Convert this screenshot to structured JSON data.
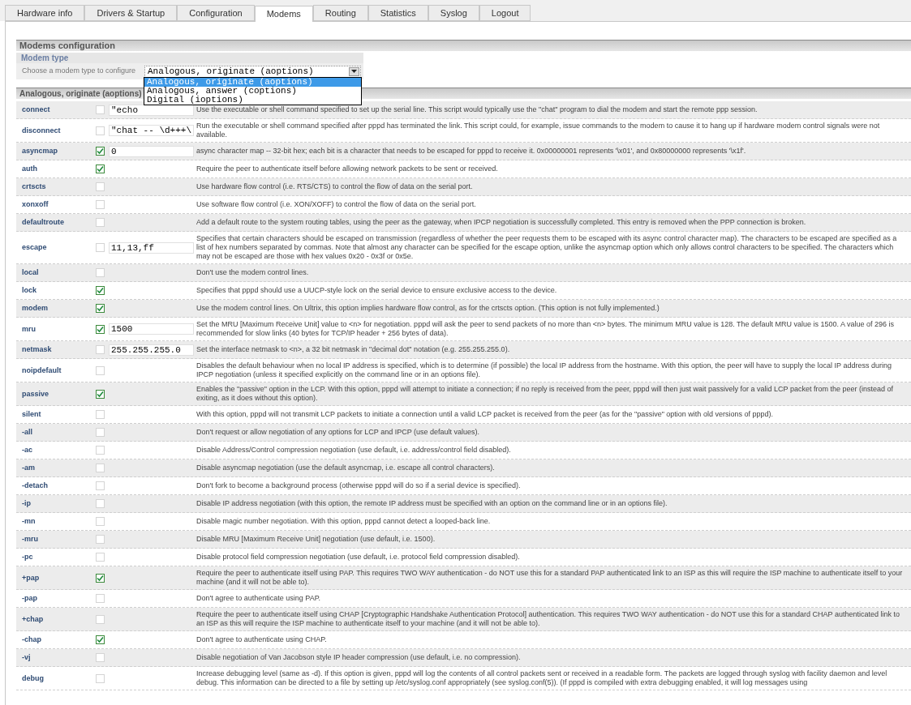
{
  "tabs": [
    {
      "label": "Hardware info",
      "selected": false
    },
    {
      "label": "Drivers & Startup",
      "selected": false
    },
    {
      "label": "Configuration",
      "selected": false
    },
    {
      "label": "Modems",
      "selected": true
    },
    {
      "label": "Routing",
      "selected": false
    },
    {
      "label": "Statistics",
      "selected": false
    },
    {
      "label": "Syslog",
      "selected": false
    },
    {
      "label": "Logout",
      "selected": false
    }
  ],
  "section_title": "Modems configuration",
  "modem_type": {
    "title": "Modem type",
    "label": "Choose a modem type to configure",
    "value": "Analogous, originate (aoptions)",
    "expanded": true,
    "options": [
      {
        "label": "Analogous, originate (aoptions)",
        "selected": true
      },
      {
        "label": "Analogous, answer (coptions)",
        "selected": false
      },
      {
        "label": "Digital (ioptions)",
        "selected": false
      }
    ]
  },
  "options_title": "Analogous, originate (aoptions)",
  "options": [
    {
      "name": "connect",
      "checked": false,
      "value": "\"echo",
      "description": "Use the executable or shell command specified to set up the serial line. This script would typically use the \"chat\" program to dial the modem and start the remote ppp session."
    },
    {
      "name": "disconnect",
      "checked": false,
      "value": "\"chat -- \\d+++\\",
      "description": "Run the executable or shell command specified after pppd has terminated the link. This script could, for example, issue commands to the modem to cause it to hang up if hardware modem control signals were not available."
    },
    {
      "name": "asyncmap",
      "checked": true,
      "value": "0",
      "description": "async character map -- 32-bit hex; each bit is a character that needs to be escaped for pppd to receive it. 0x00000001 represents '\\x01', and 0x80000000 represents '\\x1f'."
    },
    {
      "name": "auth",
      "checked": true,
      "description": "Require the peer to authenticate itself before allowing network packets to be sent or received."
    },
    {
      "name": "crtscts",
      "checked": false,
      "description": "Use hardware flow control (i.e. RTS/CTS) to control the flow of data on the serial port."
    },
    {
      "name": "xonxoff",
      "checked": false,
      "description": "Use software flow control (i.e. XON/XOFF) to control the flow of data on the serial port."
    },
    {
      "name": "defaultroute",
      "checked": false,
      "description": "Add a default route to the system routing tables, using the peer as the gateway, when IPCP negotiation is successfully completed. This entry is removed when the PPP connection is broken."
    },
    {
      "name": "escape",
      "checked": false,
      "value": "11,13,ff",
      "description": "Specifies that certain characters should be escaped on transmission (regardless of whether the peer requests them to be escaped with its async control character map). The characters to be escaped are specified as a list of hex numbers separated by commas. Note that almost any character can be specified for the escape option, unlike the asyncmap option which only allows control characters to be specified. The characters which may not be escaped are those with hex values 0x20 - 0x3f or 0x5e."
    },
    {
      "name": "local",
      "checked": false,
      "description": "Don't use the modem control lines."
    },
    {
      "name": "lock",
      "checked": true,
      "description": "Specifies that pppd should use a UUCP-style lock on the serial device to ensure exclusive access to the device."
    },
    {
      "name": "modem",
      "checked": true,
      "description": "Use the modem control lines. On Ultrix, this option implies hardware flow control, as for the crtscts option. (This option is not fully implemented.)"
    },
    {
      "name": "mru",
      "checked": true,
      "value": "1500",
      "description": "Set the MRU [Maximum Receive Unit] value to <n> for negotiation. pppd will ask the peer to send packets of no more than <n> bytes. The minimum MRU value is 128. The default MRU value is 1500. A value of 296 is recommended for slow links (40 bytes for TCP/IP header + 256 bytes of data)."
    },
    {
      "name": "netmask",
      "checked": false,
      "value": "255.255.255.0",
      "description": "Set the interface netmask to <n>, a 32 bit netmask in \"decimal dot\" notation (e.g. 255.255.255.0)."
    },
    {
      "name": "noipdefault",
      "checked": false,
      "description": "Disables the default behaviour when no local IP address is specified, which is to determine (if possible) the local IP address from the hostname. With this option, the peer will have to supply the local IP address during IPCP negotiation (unless it specified explicitly on the command line or in an options file)."
    },
    {
      "name": "passive",
      "checked": true,
      "description": "Enables the \"passive\" option in the LCP. With this option, pppd will attempt to initiate a connection; if no reply is received from the peer, pppd will then just wait passively for a valid LCP packet from the peer (instead of exiting, as it does without this option)."
    },
    {
      "name": "silent",
      "checked": false,
      "description": "With this option, pppd will not transmit LCP packets to initiate a connection until a valid LCP packet is received from the peer (as for the \"passive\" option with old versions of pppd)."
    },
    {
      "name": "-all",
      "checked": false,
      "description": "Don't request or allow negotiation of any options for LCP and IPCP (use default values)."
    },
    {
      "name": "-ac",
      "checked": false,
      "description": "Disable Address/Control compression negotiation (use default, i.e. address/control field disabled)."
    },
    {
      "name": "-am",
      "checked": false,
      "description": "Disable asyncmap negotiation (use the default asyncmap, i.e. escape all control characters)."
    },
    {
      "name": "-detach",
      "checked": false,
      "description": "Don't fork to become a background process (otherwise pppd will do so if a serial device is specified)."
    },
    {
      "name": "-ip",
      "checked": false,
      "description": "Disable IP address negotiation (with this option, the remote IP address must be specified with an option on the command line or in an options file)."
    },
    {
      "name": "-mn",
      "checked": false,
      "description": "Disable magic number negotiation. With this option, pppd cannot detect a looped-back line."
    },
    {
      "name": "-mru",
      "checked": false,
      "description": "Disable MRU [Maximum Receive Unit] negotiation (use default, i.e. 1500)."
    },
    {
      "name": "-pc",
      "checked": false,
      "description": "Disable protocol field compression negotiation (use default, i.e. protocol field compression disabled)."
    },
    {
      "name": "+pap",
      "checked": true,
      "description": "Require the peer to authenticate itself using PAP. This requires TWO WAY authentication - do NOT use this for a standard PAP authenticated link to an ISP as this will require the ISP machine to authenticate itself to your machine (and it will not be able to)."
    },
    {
      "name": "-pap",
      "checked": false,
      "description": "Don't agree to authenticate using PAP."
    },
    {
      "name": "+chap",
      "checked": false,
      "description": "Require the peer to authenticate itself using CHAP [Cryptographic Handshake Authentication Protocol] authentication. This requires TWO WAY authentication - do NOT use this for a standard CHAP authenticated link to an ISP as this will require the ISP machine to authenticate itself to your machine (and it will not be able to)."
    },
    {
      "name": "-chap",
      "checked": true,
      "description": "Don't agree to authenticate using CHAP."
    },
    {
      "name": "-vj",
      "checked": false,
      "description": "Disable negotiation of Van Jacobson style IP header compression (use default, i.e. no compression)."
    },
    {
      "name": "debug",
      "checked": false,
      "description": "Increase debugging level (same as -d). If this option is given, pppd will log the contents of all control packets sent or received in a readable form. The packets are logged through syslog with facility daemon and level debug. This information can be directed to a file by setting up /etc/syslog.conf appropriately (see syslog.conf(5)). (If pppd is compiled with extra debugging enabled, it will log messages using"
    }
  ]
}
